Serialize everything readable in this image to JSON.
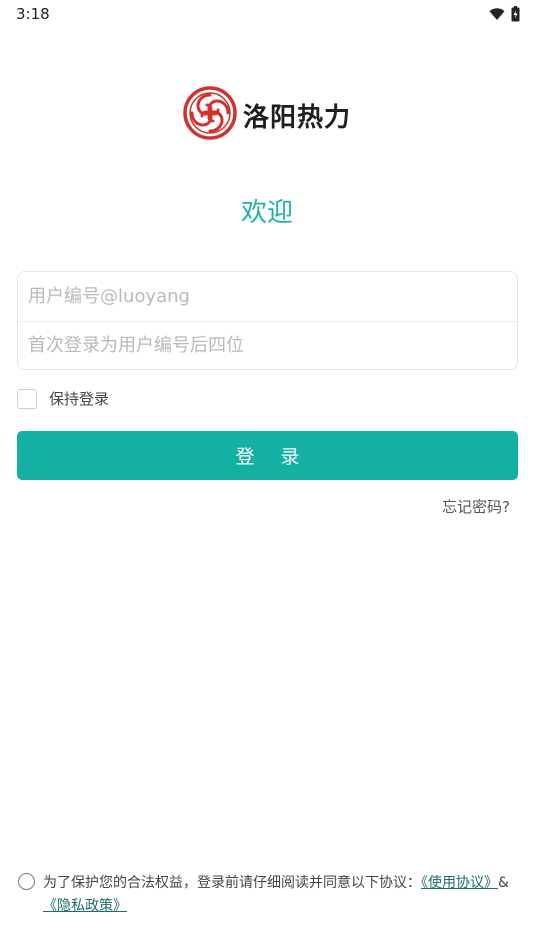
{
  "status_bar": {
    "time": "3:18",
    "wifi_icon": "wifi-icon",
    "battery_icon": "battery-charging-icon"
  },
  "logo": {
    "text": "洛阳热力",
    "emblem_icon": "luoyang-heat-emblem-icon",
    "brand_color": "#d0312d"
  },
  "welcome": "欢迎",
  "form": {
    "username_placeholder": "用户编号@luoyang",
    "password_placeholder": "首次登录为用户编号后四位",
    "keep_login_label": "保持登录",
    "login_button_label": "登 录",
    "forgot_label": "忘记密码?"
  },
  "agreement": {
    "prefix": "为了保护您的合法权益，登录前请仔细阅读并同意以下协议：",
    "terms_link": "《使用协议》",
    "separator": "&",
    "privacy_link": "《隐私政策》"
  },
  "colors": {
    "accent": "#14b0a4",
    "welcome_text": "#1fb3a6",
    "link": "#1a6f6a"
  }
}
